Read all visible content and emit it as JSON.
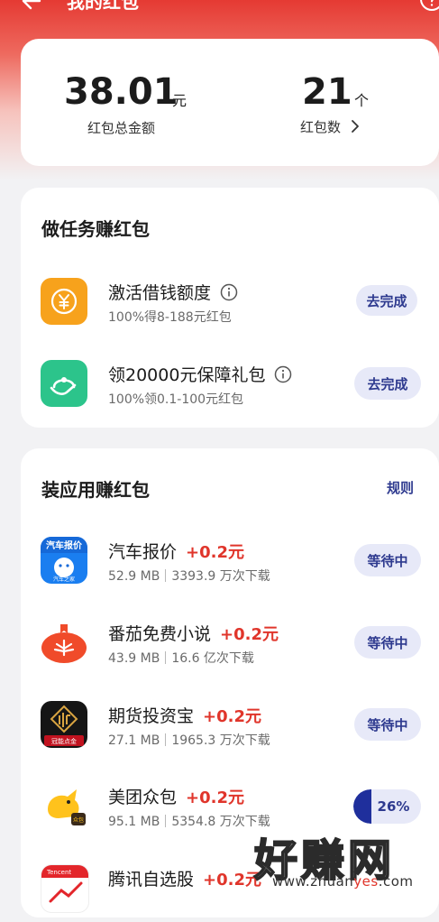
{
  "header": {
    "title": "我的红包"
  },
  "summary": {
    "amount_value": "38.01",
    "amount_unit": "元",
    "amount_label": "红包总金额",
    "count_value": "21",
    "count_unit": "个",
    "count_label": "红包数"
  },
  "tasks": {
    "title": "做任务赚红包",
    "items": [
      {
        "title": "激活借钱额度",
        "subtitle": "100%得8-188元红包",
        "action": "去完成"
      },
      {
        "title": "领20000元保障礼包",
        "subtitle": "100%领0.1-100元红包",
        "action": "去完成"
      }
    ]
  },
  "apps": {
    "title": "装应用赚红包",
    "rules_label": "规则",
    "items": [
      {
        "name": "汽车报价",
        "reward": "+0.2元",
        "size": "52.9 MB",
        "downloads": "3393.9 万次下载",
        "status": "等待中",
        "icon_text": "汽车报价",
        "icon_sub": "汽车之家"
      },
      {
        "name": "番茄免费小说",
        "reward": "+0.2元",
        "size": "43.9 MB",
        "downloads": "16.6 亿次下载",
        "status": "等待中"
      },
      {
        "name": "期货投资宝",
        "reward": "+0.2元",
        "size": "27.1 MB",
        "downloads": "1965.3 万次下载",
        "status": "等待中",
        "icon_text": "冠能点金"
      },
      {
        "name": "美团众包",
        "reward": "+0.2元",
        "size": "95.1 MB",
        "downloads": "5354.8 万次下载",
        "status": "26%",
        "progress": 0.26,
        "icon_text": "众包"
      },
      {
        "name": "腾讯自选股",
        "reward": "+0.2元",
        "icon_text": "Tencent"
      }
    ]
  },
  "watermark": {
    "text": "好赚网",
    "url_prefix": "www.zhuan",
    "url_highlight": "yes",
    "url_suffix": ".com"
  },
  "colors": {
    "brand_red": "#e53a33",
    "accent_blue": "#2e3a8f",
    "reward_red": "#e0352b"
  }
}
